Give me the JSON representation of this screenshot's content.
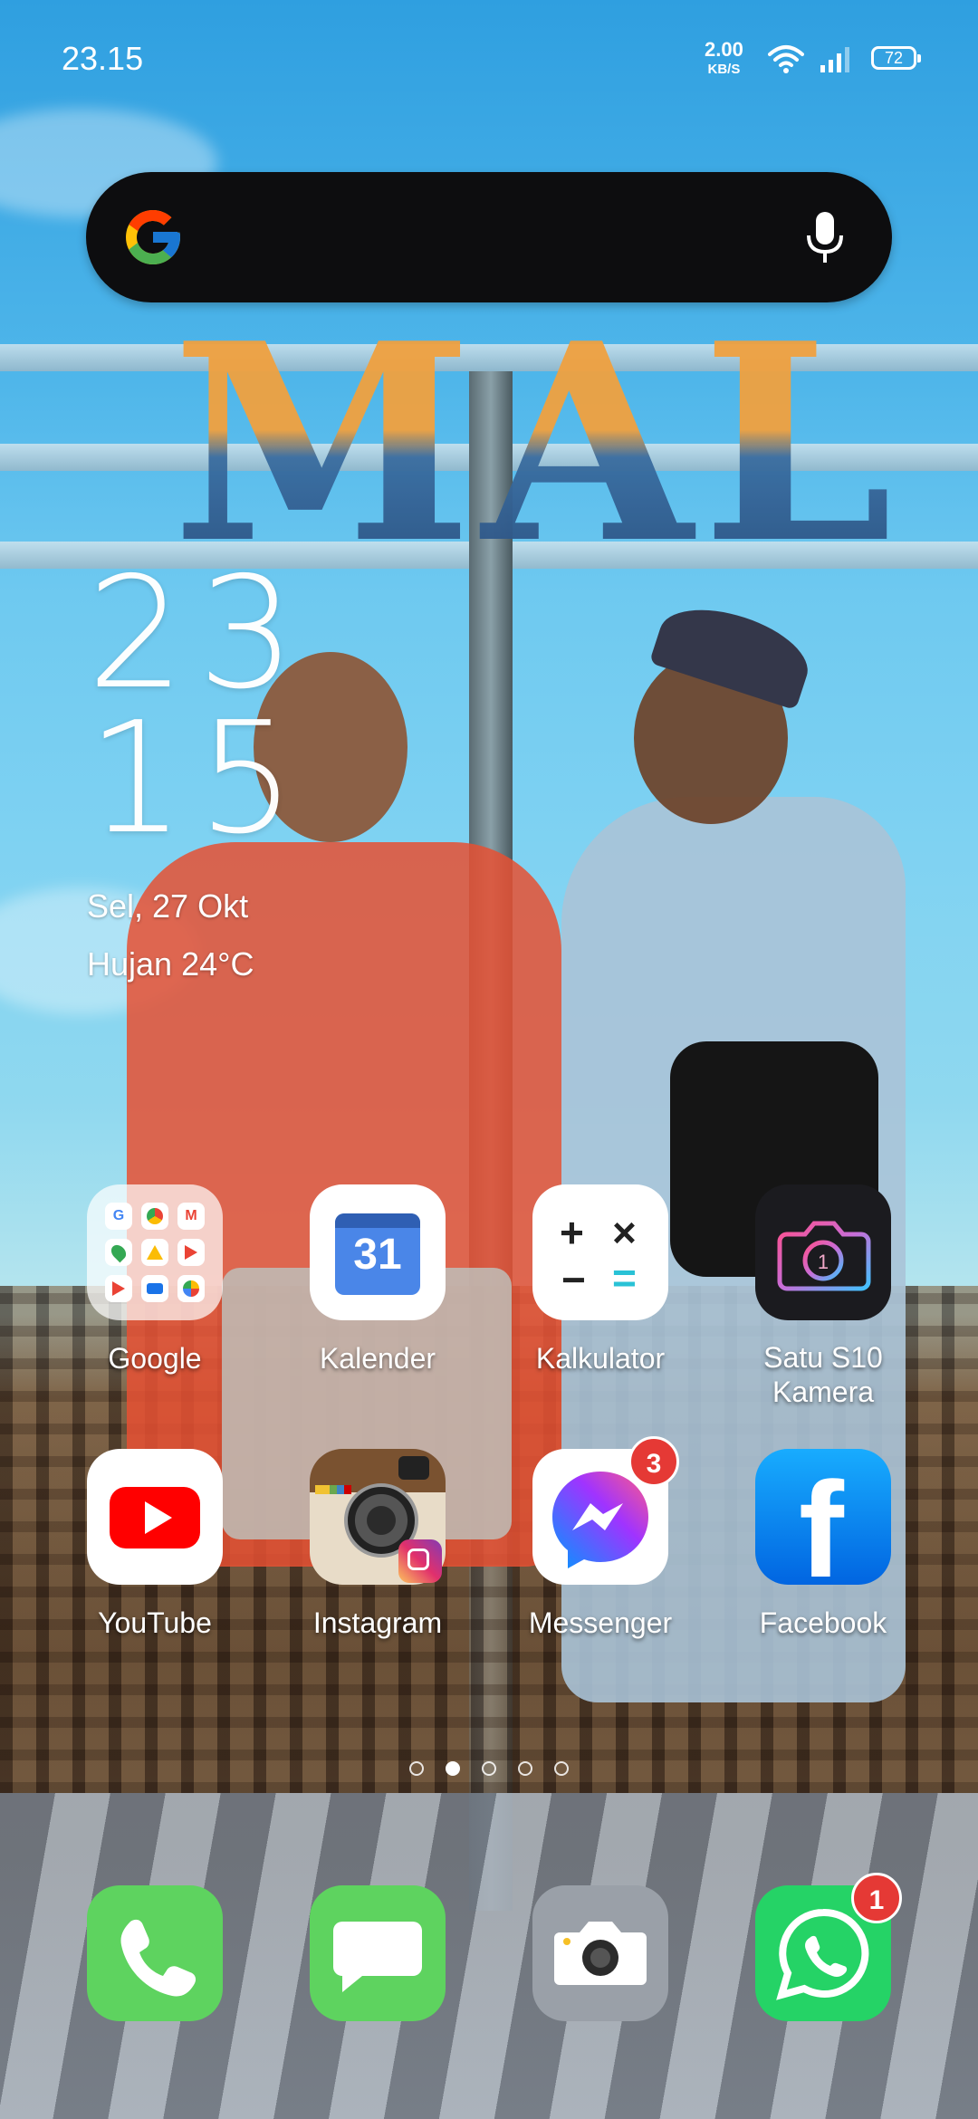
{
  "status_bar": {
    "time": "23.15",
    "net_speed_value": "2.00",
    "net_speed_unit": "KB/S",
    "battery": "72"
  },
  "search": {
    "placeholder": ""
  },
  "clock_widget": {
    "hour": "23",
    "minute": "15",
    "date": "Sel, 27 Okt",
    "weather": "Hujan 24°C"
  },
  "apps": {
    "row1": [
      {
        "label": "Google",
        "icon": "google-folder-icon"
      },
      {
        "label": "Kalender",
        "icon": "calendar-icon",
        "day": "31"
      },
      {
        "label": "Kalkulator",
        "icon": "calculator-icon"
      },
      {
        "label": "Satu S10 Kamera",
        "label_line1": "Satu S10",
        "label_line2": "Kamera",
        "icon": "camera-s10-icon"
      }
    ],
    "row2": [
      {
        "label": "YouTube",
        "icon": "youtube-icon"
      },
      {
        "label": "Instagram",
        "icon": "instagram-icon"
      },
      {
        "label": "Messenger",
        "icon": "messenger-icon",
        "badge": "3"
      },
      {
        "label": "Facebook",
        "icon": "facebook-icon"
      }
    ]
  },
  "dock": [
    {
      "icon": "phone-icon"
    },
    {
      "icon": "messages-icon"
    },
    {
      "icon": "camera-icon"
    },
    {
      "icon": "whatsapp-icon",
      "badge": "1"
    }
  ],
  "pages": {
    "count": 5,
    "active": 2
  },
  "colors": {
    "badge_red": "#e53935",
    "dock_green": "#5ed35f",
    "whatsapp_green": "#25d366",
    "facebook_blue": "#1877f2",
    "youtube_red": "#ff0000"
  }
}
